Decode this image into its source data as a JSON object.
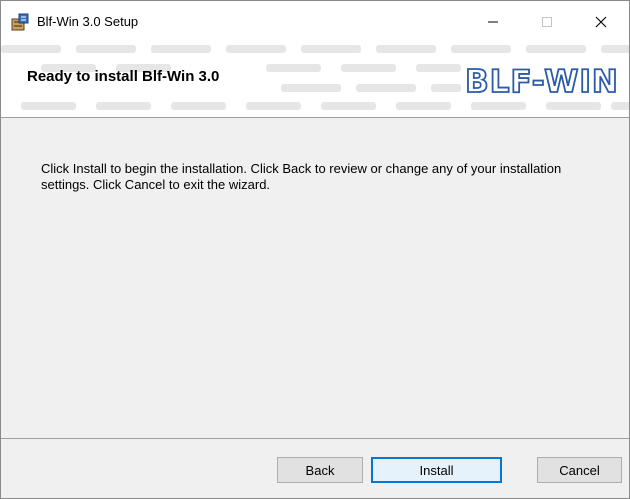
{
  "window": {
    "title": "Blf-Win 3.0 Setup"
  },
  "banner": {
    "heading": "Ready to install Blf-Win 3.0",
    "logo_text": "BLF-WIN"
  },
  "body": {
    "message": "Click Install to begin the installation. Click Back to review or change any of your installation settings. Click Cancel to exit the wizard."
  },
  "buttons": {
    "back": "Back",
    "install": "Install",
    "cancel": "Cancel"
  },
  "icons": {
    "app": "setup-package-icon",
    "minimize": "minimize-icon",
    "maximize": "maximize-icon",
    "close": "close-icon"
  },
  "colors": {
    "accent": "#0078d7",
    "logo": "#2a5aa8",
    "dialog_bg": "#f0f0f0"
  }
}
